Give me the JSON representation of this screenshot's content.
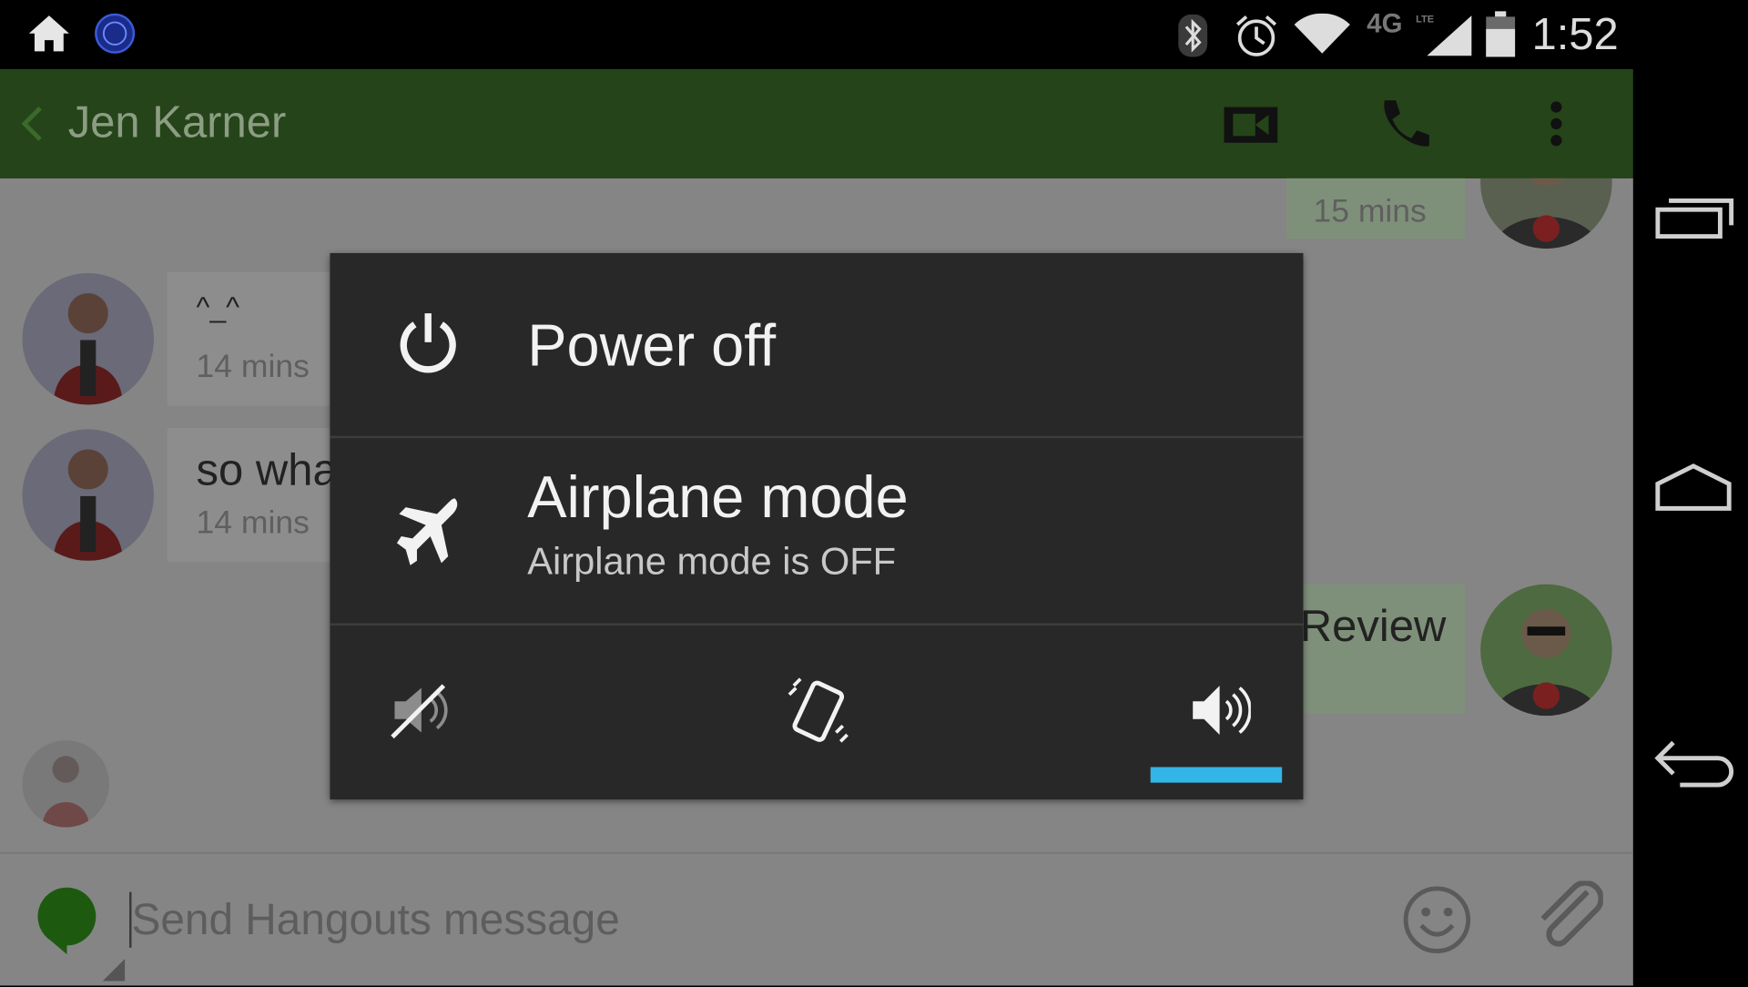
{
  "status_bar": {
    "time": "1:52",
    "network": "4G",
    "network_sub": "LTE",
    "icons": [
      "home-icon",
      "duo-app-icon",
      "bluetooth-icon",
      "alarm-icon",
      "wifi-icon",
      "signal-icon",
      "battery-icon"
    ]
  },
  "app_bar": {
    "contact_name": "Jen Karner",
    "actions": [
      "video-call-icon",
      "phone-icon",
      "overflow-menu-icon"
    ],
    "color": "#254419"
  },
  "messages": [
    {
      "direction": "out",
      "text": "",
      "time": "15 mins"
    },
    {
      "direction": "in",
      "text": "^_^",
      "time": "14 mins"
    },
    {
      "direction": "in",
      "text": "so wha",
      "time": "14 mins"
    },
    {
      "direction": "out",
      "text": "Review",
      "time": ""
    }
  ],
  "compose": {
    "placeholder": "Send Hangouts message",
    "icons": [
      "hangouts-icon",
      "emoji-icon",
      "attach-icon"
    ]
  },
  "power_dialog": {
    "items": [
      {
        "label": "Power off",
        "icon": "power-icon"
      },
      {
        "label": "Airplane mode",
        "sublabel": "Airplane mode is OFF",
        "icon": "airplane-icon"
      }
    ],
    "sound_modes": [
      {
        "name": "silent",
        "icon": "silent-icon"
      },
      {
        "name": "vibrate",
        "icon": "vibrate-icon"
      },
      {
        "name": "sound",
        "icon": "sound-on-icon",
        "selected": true
      }
    ],
    "accent": "#33b5e5"
  },
  "nav_bar": {
    "buttons": [
      "recents-button",
      "home-button",
      "back-button"
    ]
  }
}
